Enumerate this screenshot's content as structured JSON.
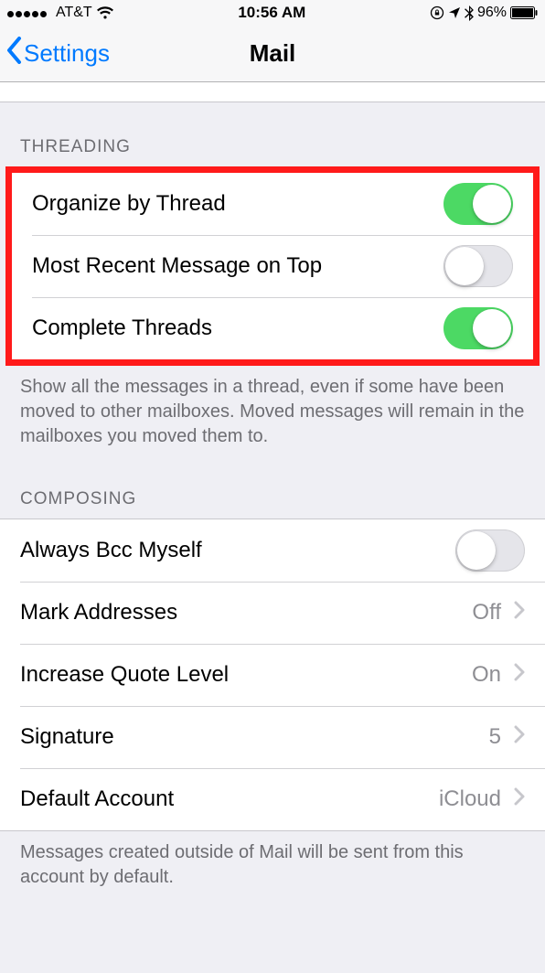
{
  "statusbar": {
    "carrier": "AT&T",
    "time": "10:56 AM",
    "battery_pct": "96%"
  },
  "nav": {
    "back_label": "Settings",
    "title": "Mail"
  },
  "sections": {
    "threading": {
      "header": "THREADING",
      "organize_label": "Organize by Thread",
      "organize_on": true,
      "recent_top_label": "Most Recent Message on Top",
      "recent_top_on": false,
      "complete_label": "Complete Threads",
      "complete_on": true,
      "footer": "Show all the messages in a thread, even if some have been moved to other mailboxes. Moved messages will remain in the mailboxes you moved them to."
    },
    "composing": {
      "header": "COMPOSING",
      "bcc_label": "Always Bcc Myself",
      "bcc_on": false,
      "mark_label": "Mark Addresses",
      "mark_value": "Off",
      "quote_label": "Increase Quote Level",
      "quote_value": "On",
      "sig_label": "Signature",
      "sig_value": "5",
      "default_label": "Default Account",
      "default_value": "iCloud",
      "footer": "Messages created outside of Mail will be sent from this account by default."
    }
  }
}
